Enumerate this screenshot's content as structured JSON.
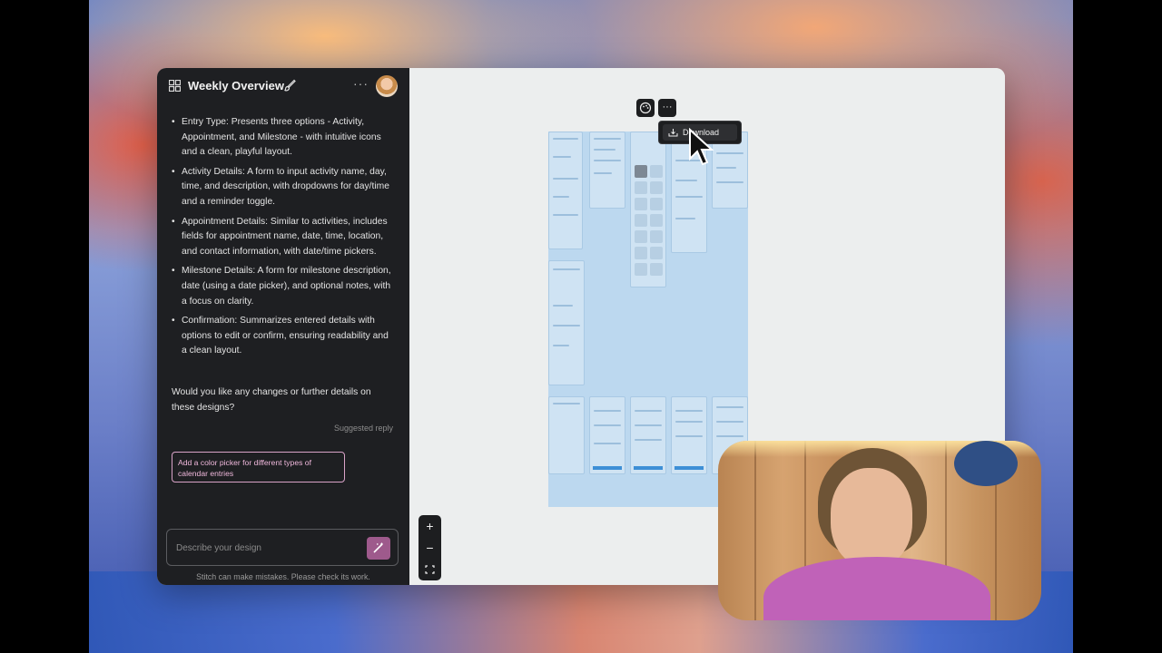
{
  "chat": {
    "title": "Weekly Overview",
    "bullets": [
      "Entry Type: Presents three options - Activity, Appointment, and Milestone - with intuitive icons and a clean, playful layout.",
      "Activity Details: A form to input activity name, day, time, and description, with dropdowns for day/time and a reminder toggle.",
      "Appointment Details: Similar to activities, includes fields for appointment name, date, time, location, and contact information, with date/time pickers.",
      "Milestone Details: A form for milestone description, date (using a date picker), and optional notes, with a focus on clarity.",
      "Confirmation: Summarizes entered details with options to edit or confirm, ensuring readability and a clean layout."
    ],
    "followup": "Would you like any changes or further details on these designs?",
    "suggested_label": "Suggested reply",
    "suggestion": "Add a color picker for different types of calendar entries",
    "input_placeholder": "Describe your design",
    "disclaimer": "Stitch can make mistakes. Please check its work."
  },
  "canvas": {
    "menu_download": "Download",
    "zoom_in": "+",
    "zoom_out": "−"
  },
  "colors": {
    "panel_bg": "#1e1f22",
    "canvas_bg": "#eceeee",
    "artboard": "#bcd8ef",
    "accent_pink": "#9e5a8c"
  }
}
